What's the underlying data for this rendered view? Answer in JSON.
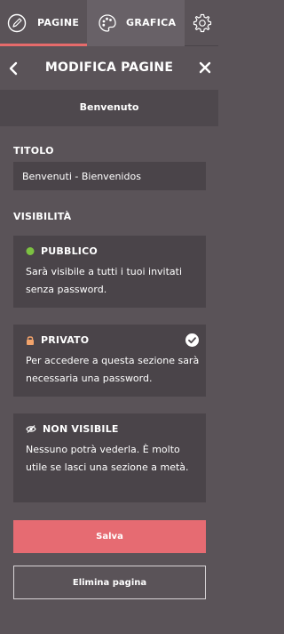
{
  "tabs": {
    "pagine": {
      "label": "PAGINE",
      "icon": "pencil-circle-icon"
    },
    "grafica": {
      "label": "GRAFICA",
      "icon": "palette-icon"
    },
    "settings": {
      "icon": "gear-icon"
    }
  },
  "header": {
    "title": "MODIFICA PAGINE",
    "back_icon": "chevron-left-icon",
    "close_icon": "close-icon"
  },
  "subheader": {
    "title": "Benvenuto"
  },
  "form": {
    "title_label": "TITOLO",
    "title_value": "Benvenuti - Bienvenidos",
    "visibility_label": "VISIBILITÀ"
  },
  "visibility": {
    "pubblico": {
      "title": "PUBBLICO",
      "description": "Sarà visibile a tutti i tuoi invitati senza password.",
      "icon": "green-dot-icon"
    },
    "privato": {
      "title": "PRIVATO",
      "description": "Per accedere a questa sezione sarà necessaria una password.",
      "icon": "lock-icon",
      "selected": true
    },
    "non_visibile": {
      "title": "NON VISIBILE",
      "description": "Nessuno potrà vederla. È molto utile se lasci una sezione a metà.",
      "icon": "eye-slash-icon"
    }
  },
  "buttons": {
    "save": "Salva",
    "delete": "Elimina pagina"
  },
  "colors": {
    "background": "#5a5358",
    "panel": "#4a4449",
    "accent": "#e66b72",
    "green": "#7cc142",
    "lock": "#f2a36b"
  }
}
